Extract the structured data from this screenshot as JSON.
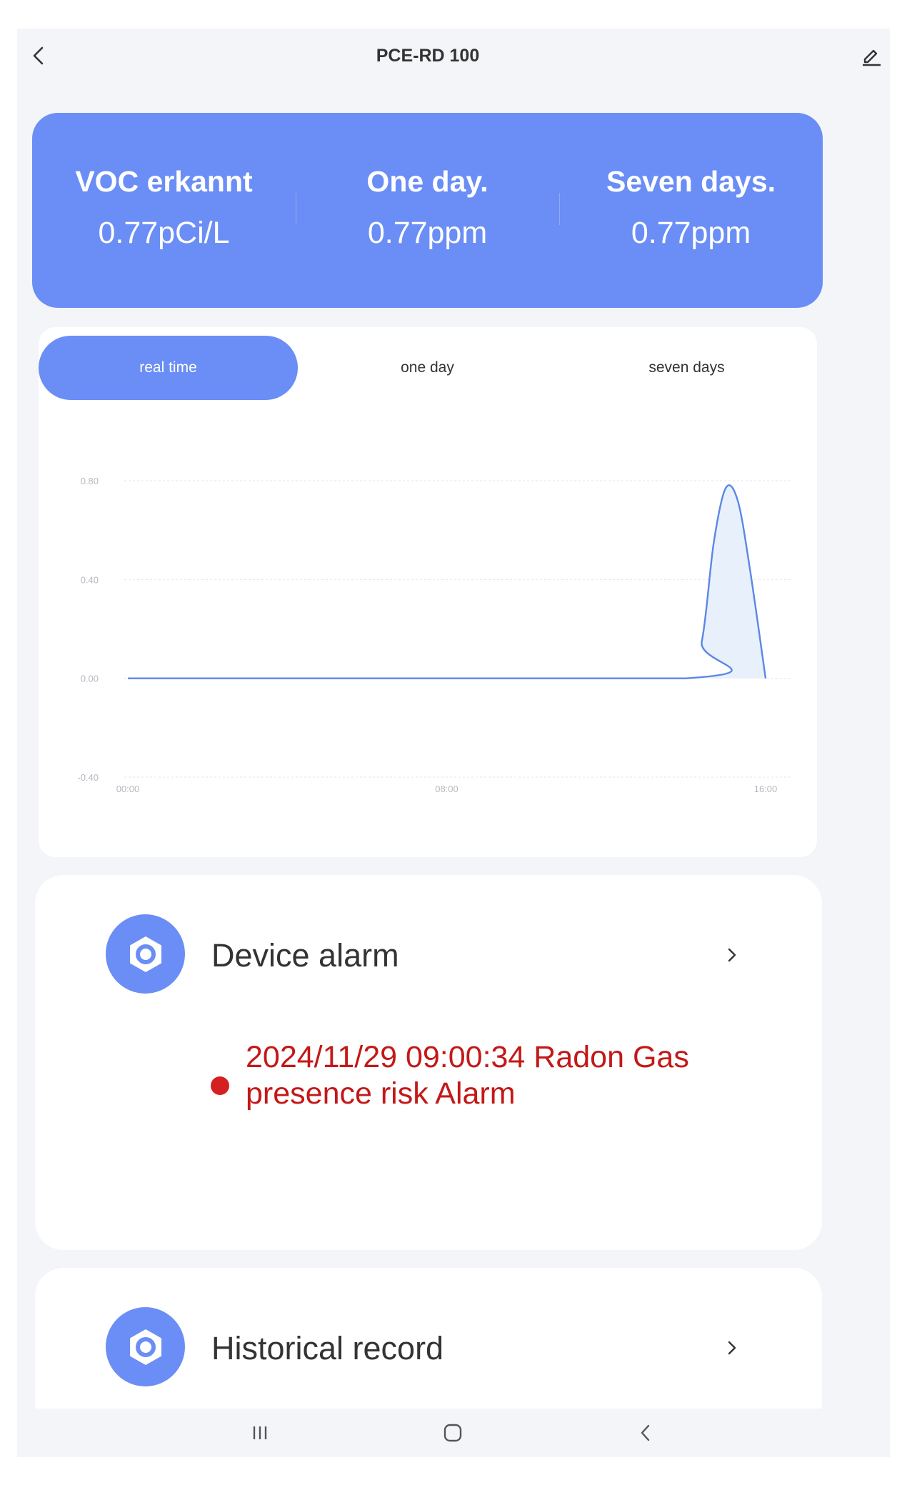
{
  "header": {
    "title": "PCE-RD 100"
  },
  "stats": [
    {
      "label": "VOC erkannt",
      "value": "0.77pCi/L"
    },
    {
      "label": "One day.",
      "value": "0.77ppm"
    },
    {
      "label": "Seven days.",
      "value": "0.77ppm"
    }
  ],
  "tabs": [
    {
      "label": "real time",
      "active": true
    },
    {
      "label": "one day",
      "active": false
    },
    {
      "label": "seven days",
      "active": false
    }
  ],
  "chart_data": {
    "type": "line",
    "x": [
      "00:00",
      "08:00",
      "16:00"
    ],
    "y_ticks": [
      "0.80",
      "0.40",
      "0.00",
      "-0.40"
    ],
    "ylim": [
      -0.4,
      0.8
    ],
    "xlim_hours": [
      0,
      16
    ],
    "grid": true,
    "series": [
      {
        "points": [
          [
            0,
            0
          ],
          [
            14,
            0
          ],
          [
            14.4,
            0.15
          ],
          [
            14.7,
            0.55
          ],
          [
            15.0,
            0.77
          ],
          [
            15.3,
            0.72
          ],
          [
            15.6,
            0.45
          ],
          [
            16,
            0
          ]
        ]
      }
    ],
    "colors": {
      "line": "#5b87e6",
      "fill": "#e8f0fc"
    }
  },
  "alarm": {
    "label": "Device alarm",
    "entries": [
      {
        "text": "2024/11/29 09:00:34 Radon Gas presence risk Alarm"
      }
    ]
  },
  "history": {
    "label": "Historical record"
  },
  "icons": {
    "back": "chevron-left-icon",
    "edit": "pencil-icon",
    "row": "hex-nut-icon",
    "row_arrow": "chevron-right-icon"
  },
  "colors": {
    "accent": "#6a8ef5",
    "alarm": "#c41818",
    "background": "#f4f5f9"
  }
}
